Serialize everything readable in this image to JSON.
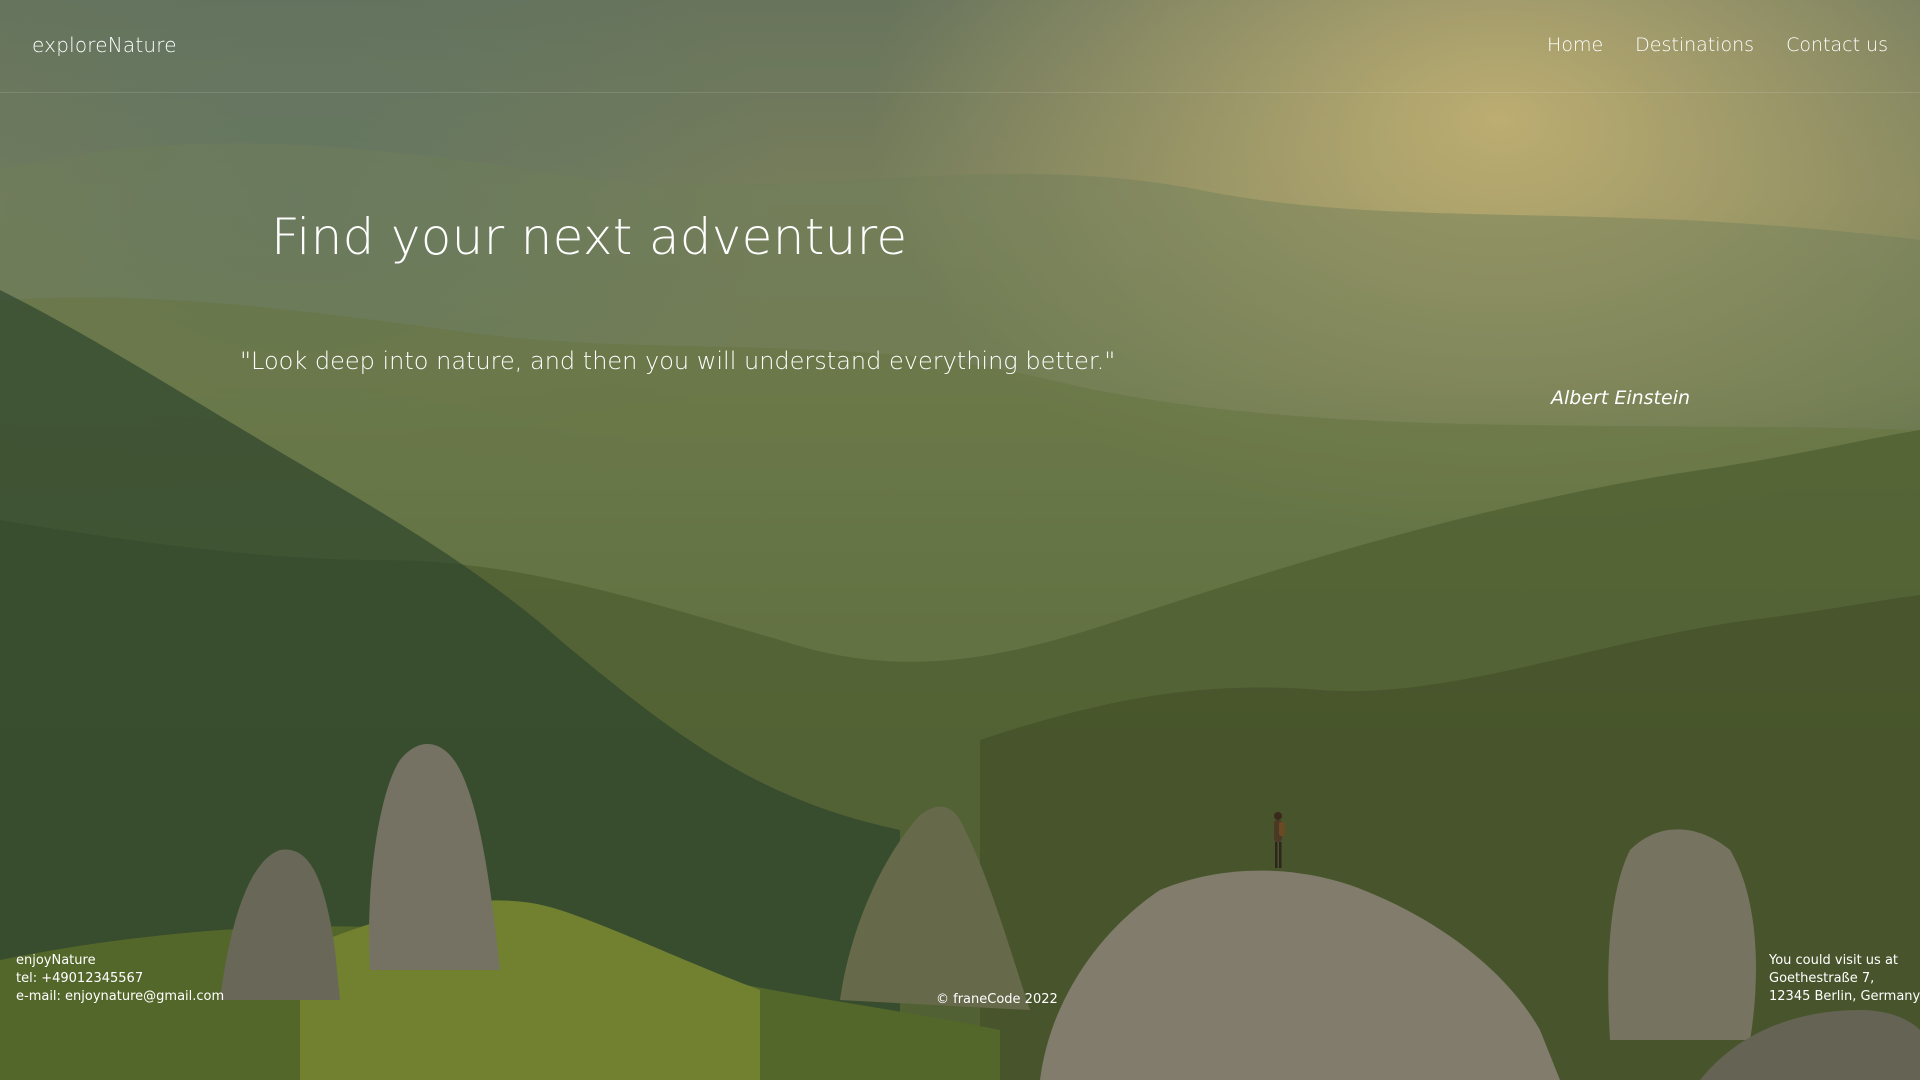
{
  "header": {
    "brand": "exploreNature",
    "nav": [
      {
        "label": "Home"
      },
      {
        "label": "Destinations"
      },
      {
        "label": "Contact us"
      }
    ]
  },
  "hero": {
    "title": "Find your next adventure",
    "quote": "\"Look deep into nature, and then you will understand everything better.\"",
    "author": "Albert Einstein"
  },
  "footer": {
    "left": {
      "name": "enjoyNature",
      "tel": "tel: +49012345567",
      "email": "e-mail: enjoynature@gmail.com"
    },
    "copyright": "© franeCode 2022",
    "right": {
      "line1": "You could visit us at",
      "line2": "Goethestraße 7,",
      "line3": "12345 Berlin, Germany"
    }
  },
  "colors": {
    "text": "#ffffff",
    "foliage_dark": "#3a4a22",
    "sunlight": "#e6cd82"
  },
  "background_image": "mountain-landscape-with-hiker"
}
